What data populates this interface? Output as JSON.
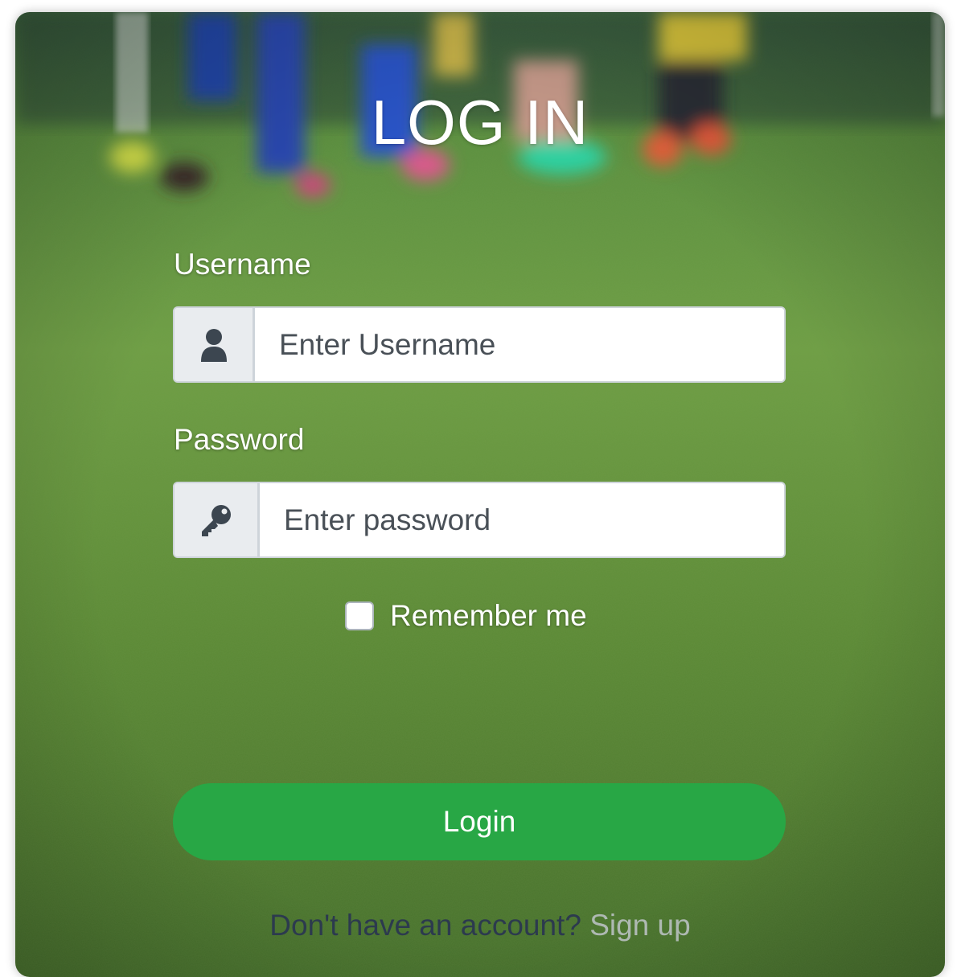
{
  "page": {
    "title": "LOG IN"
  },
  "form": {
    "username_label": "Username",
    "username_placeholder": "Enter Username",
    "password_label": "Password",
    "password_placeholder": "Enter password",
    "remember_label": "Remember me",
    "login_label": "Login"
  },
  "footer": {
    "prompt": "Don't have an account?",
    "signup_label": "Sign up"
  },
  "icons": {
    "username": "user-icon",
    "password": "key-icon"
  },
  "colors": {
    "accent": "#28a745",
    "addon_bg": "#e9ecef",
    "link": "#aeb9b2"
  }
}
